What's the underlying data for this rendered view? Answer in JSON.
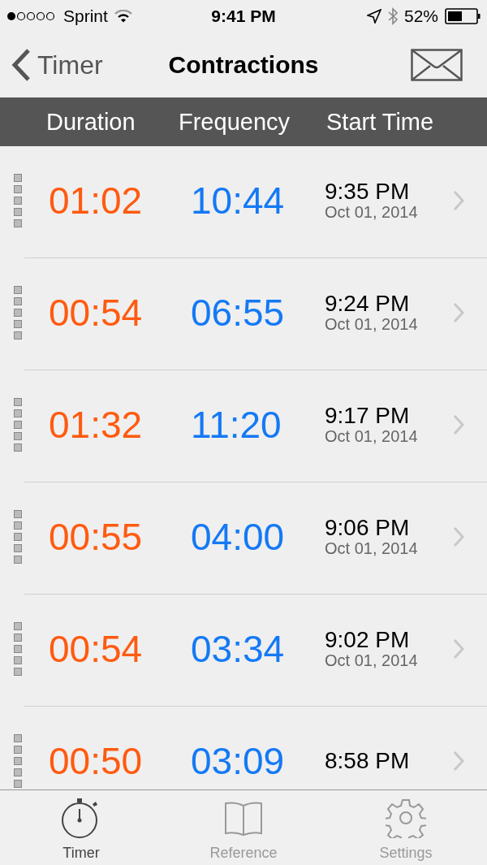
{
  "status_bar": {
    "carrier": "Sprint",
    "time": "9:41 PM",
    "battery": "52%"
  },
  "nav": {
    "back": "Timer",
    "title": "Contractions"
  },
  "columns": [
    "Duration",
    "Frequency",
    "Start Time"
  ],
  "rows": [
    {
      "duration": "01:02",
      "frequency": "10:44",
      "time": "9:35 PM",
      "date": "Oct 01, 2014"
    },
    {
      "duration": "00:54",
      "frequency": "06:55",
      "time": "9:24 PM",
      "date": "Oct 01, 2014"
    },
    {
      "duration": "01:32",
      "frequency": "11:20",
      "time": "9:17 PM",
      "date": "Oct 01, 2014"
    },
    {
      "duration": "00:55",
      "frequency": "04:00",
      "time": "9:06 PM",
      "date": "Oct 01, 2014"
    },
    {
      "duration": "00:54",
      "frequency": "03:34",
      "time": "9:02 PM",
      "date": "Oct 01, 2014"
    },
    {
      "duration": "00:50",
      "frequency": "03:09",
      "time": "8:58 PM"
    }
  ],
  "tabs": [
    {
      "label": "Timer",
      "kind": "timer",
      "selected": true
    },
    {
      "label": "Reference",
      "kind": "book",
      "selected": false
    },
    {
      "label": "Settings",
      "kind": "gear",
      "selected": false
    }
  ]
}
